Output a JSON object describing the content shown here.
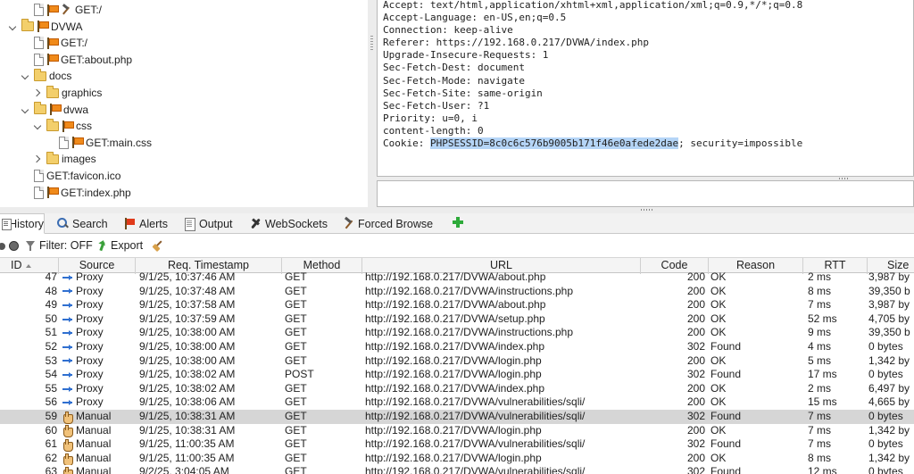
{
  "tree": {
    "items": [
      {
        "label": "GET:/",
        "level": 2,
        "expander": "none",
        "kind": "page-flag-hammer"
      },
      {
        "label": "DVWA",
        "level": 1,
        "expander": "down",
        "kind": "folder-flag"
      },
      {
        "label": "GET:/",
        "level": 2,
        "expander": "none",
        "kind": "page-flag"
      },
      {
        "label": "GET:about.php",
        "level": 2,
        "expander": "none",
        "kind": "page-flag"
      },
      {
        "label": "docs",
        "level": 2,
        "expander": "down",
        "kind": "folder"
      },
      {
        "label": "graphics",
        "level": 3,
        "expander": "right",
        "kind": "folder"
      },
      {
        "label": "dvwa",
        "level": 2,
        "expander": "down",
        "kind": "folder-flag"
      },
      {
        "label": "css",
        "level": 3,
        "expander": "down",
        "kind": "folder-flag"
      },
      {
        "label": "GET:main.css",
        "level": 4,
        "expander": "none",
        "kind": "page-flag"
      },
      {
        "label": "images",
        "level": 3,
        "expander": "right",
        "kind": "folder"
      },
      {
        "label": "GET:favicon.ico",
        "level": 2,
        "expander": "none",
        "kind": "page"
      },
      {
        "label": "GET:index.php",
        "level": 2,
        "expander": "none",
        "kind": "page-flag"
      }
    ]
  },
  "request_headers": {
    "lines": [
      "Accept: text/html,application/xhtml+xml,application/xml;q=0.9,*/*;q=0.8",
      "Accept-Language: en-US,en;q=0.5",
      "Connection: keep-alive",
      "Referer: https://192.168.0.217/DVWA/index.php",
      "Upgrade-Insecure-Requests: 1",
      "Sec-Fetch-Dest: document",
      "Sec-Fetch-Mode: navigate",
      "Sec-Fetch-Site: same-origin",
      "Sec-Fetch-User: ?1",
      "Priority: u=0, i",
      "content-length: 0"
    ],
    "cookie_prefix": "Cookie: ",
    "cookie_selected": "PHPSESSID=8c0c6c576b9005b171f46e0afede2dae",
    "cookie_rest": "; security=impossible"
  },
  "tabs": [
    {
      "label": "History",
      "icon": "history-icon",
      "active": true
    },
    {
      "label": "Search",
      "icon": "search-icon"
    },
    {
      "label": "Alerts",
      "icon": "alerts-flag-icon"
    },
    {
      "label": "Output",
      "icon": "output-icon"
    },
    {
      "label": "WebSockets",
      "icon": "websockets-icon"
    },
    {
      "label": "Forced Browse",
      "icon": "forced-browse-icon"
    }
  ],
  "toolbar": {
    "filter_label": "Filter: OFF",
    "export_label": "Export"
  },
  "table": {
    "columns": [
      "ID",
      "Source",
      "Req. Timestamp",
      "Method",
      "URL",
      "Code",
      "Reason",
      "RTT",
      "Size"
    ],
    "rows": [
      {
        "id": "47",
        "source": "Proxy",
        "ts": "9/1/25, 10:37:46 AM",
        "method": "GET",
        "url": "http://192.168.0.217/DVWA/about.php",
        "code": "200",
        "reason": "OK",
        "rtt": "2 ms",
        "size": "3,987 by"
      },
      {
        "id": "48",
        "source": "Proxy",
        "ts": "9/1/25, 10:37:48 AM",
        "method": "GET",
        "url": "http://192.168.0.217/DVWA/instructions.php",
        "code": "200",
        "reason": "OK",
        "rtt": "8 ms",
        "size": "39,350 b"
      },
      {
        "id": "49",
        "source": "Proxy",
        "ts": "9/1/25, 10:37:58 AM",
        "method": "GET",
        "url": "http://192.168.0.217/DVWA/about.php",
        "code": "200",
        "reason": "OK",
        "rtt": "7 ms",
        "size": "3,987 by"
      },
      {
        "id": "50",
        "source": "Proxy",
        "ts": "9/1/25, 10:37:59 AM",
        "method": "GET",
        "url": "http://192.168.0.217/DVWA/setup.php",
        "code": "200",
        "reason": "OK",
        "rtt": "52 ms",
        "size": "4,705 by"
      },
      {
        "id": "51",
        "source": "Proxy",
        "ts": "9/1/25, 10:38:00 AM",
        "method": "GET",
        "url": "http://192.168.0.217/DVWA/instructions.php",
        "code": "200",
        "reason": "OK",
        "rtt": "9 ms",
        "size": "39,350 b"
      },
      {
        "id": "52",
        "source": "Proxy",
        "ts": "9/1/25, 10:38:00 AM",
        "method": "GET",
        "url": "http://192.168.0.217/DVWA/index.php",
        "code": "302",
        "reason": "Found",
        "rtt": "4 ms",
        "size": "0 bytes"
      },
      {
        "id": "53",
        "source": "Proxy",
        "ts": "9/1/25, 10:38:00 AM",
        "method": "GET",
        "url": "http://192.168.0.217/DVWA/login.php",
        "code": "200",
        "reason": "OK",
        "rtt": "5 ms",
        "size": "1,342 by"
      },
      {
        "id": "54",
        "source": "Proxy",
        "ts": "9/1/25, 10:38:02 AM",
        "method": "POST",
        "url": "http://192.168.0.217/DVWA/login.php",
        "code": "302",
        "reason": "Found",
        "rtt": "17 ms",
        "size": "0 bytes"
      },
      {
        "id": "55",
        "source": "Proxy",
        "ts": "9/1/25, 10:38:02 AM",
        "method": "GET",
        "url": "http://192.168.0.217/DVWA/index.php",
        "code": "200",
        "reason": "OK",
        "rtt": "2 ms",
        "size": "6,497 by"
      },
      {
        "id": "56",
        "source": "Proxy",
        "ts": "9/1/25, 10:38:06 AM",
        "method": "GET",
        "url": "http://192.168.0.217/DVWA/vulnerabilities/sqli/",
        "code": "200",
        "reason": "OK",
        "rtt": "15 ms",
        "size": "4,665 by"
      },
      {
        "id": "59",
        "source": "Manual",
        "ts": "9/1/25, 10:38:31 AM",
        "method": "GET",
        "url": "http://192.168.0.217/DVWA/vulnerabilities/sqli/",
        "code": "302",
        "reason": "Found",
        "rtt": "7 ms",
        "size": "0 bytes",
        "selected": true
      },
      {
        "id": "60",
        "source": "Manual",
        "ts": "9/1/25, 10:38:31 AM",
        "method": "GET",
        "url": "http://192.168.0.217/DVWA/login.php",
        "code": "200",
        "reason": "OK",
        "rtt": "7 ms",
        "size": "1,342 by"
      },
      {
        "id": "61",
        "source": "Manual",
        "ts": "9/1/25, 11:00:35 AM",
        "method": "GET",
        "url": "http://192.168.0.217/DVWA/vulnerabilities/sqli/",
        "code": "302",
        "reason": "Found",
        "rtt": "7 ms",
        "size": "0 bytes"
      },
      {
        "id": "62",
        "source": "Manual",
        "ts": "9/1/25, 11:00:35 AM",
        "method": "GET",
        "url": "http://192.168.0.217/DVWA/login.php",
        "code": "200",
        "reason": "OK",
        "rtt": "8 ms",
        "size": "1,342 by"
      },
      {
        "id": "63",
        "source": "Manual",
        "ts": "9/2/25, 3:04:05 AM",
        "method": "GET",
        "url": "http://192.168.0.217/DVWA/vulnerabilities/sqli/",
        "code": "302",
        "reason": "Found",
        "rtt": "12 ms",
        "size": "0 bytes"
      }
    ]
  }
}
